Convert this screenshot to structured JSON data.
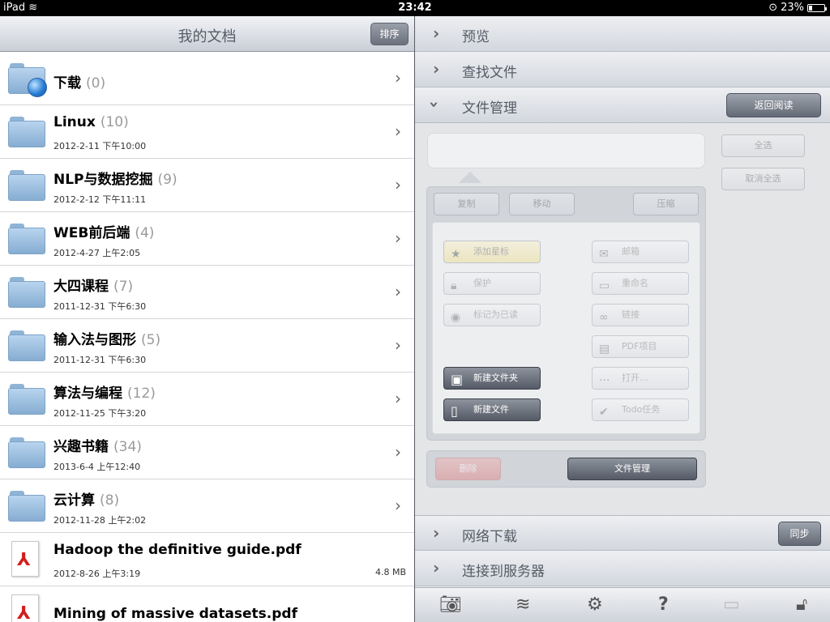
{
  "status": {
    "device": "iPad",
    "time": "23:42",
    "battery": "23%",
    "battery_level": 0.23
  },
  "left": {
    "title": "我的文档",
    "sort_label": "排序",
    "rows": [
      {
        "name": "下载",
        "count": "(0)",
        "date": "",
        "size": "",
        "kind": "download-folder"
      },
      {
        "name": "Linux",
        "count": "(10)",
        "date": "2012-2-11 下午10:00",
        "size": "",
        "kind": "folder"
      },
      {
        "name": "NLP与数据挖掘",
        "count": "(9)",
        "date": "2012-2-12 下午11:11",
        "size": "",
        "kind": "folder"
      },
      {
        "name": "WEB前后端",
        "count": "(4)",
        "date": "2012-4-27 上午2:05",
        "size": "",
        "kind": "folder"
      },
      {
        "name": "大四课程",
        "count": "(7)",
        "date": "2011-12-31 下午6:30",
        "size": "",
        "kind": "folder"
      },
      {
        "name": "输入法与图形",
        "count": "(5)",
        "date": "2011-12-31 下午6:30",
        "size": "",
        "kind": "folder"
      },
      {
        "name": "算法与编程",
        "count": "(12)",
        "date": "2012-11-25 下午3:20",
        "size": "",
        "kind": "folder"
      },
      {
        "name": "兴趣书籍",
        "count": "(34)",
        "date": "2013-6-4 上午12:40",
        "size": "",
        "kind": "folder"
      },
      {
        "name": "云计算",
        "count": "(8)",
        "date": "2012-11-28 上午2:02",
        "size": "",
        "kind": "folder"
      },
      {
        "name": "Hadoop the definitive guide.pdf",
        "count": "",
        "date": "2012-8-26 上午3:19",
        "size": "4.8 MB",
        "kind": "pdf"
      },
      {
        "name": "Mining of massive datasets.pdf",
        "count": "",
        "date": "",
        "size": "",
        "kind": "pdf"
      }
    ]
  },
  "right": {
    "sections": {
      "preview": "预览",
      "find": "查找文件",
      "manage": "文件管理",
      "back_to_reading": "返回阅读",
      "network": "网络下载",
      "sync": "同步",
      "server": "连接到服务器"
    },
    "panel": {
      "select_all": "全选",
      "deselect_all": "取消全选",
      "copy": "复制",
      "move": "移动",
      "compress": "压缩",
      "add_star": "添加星标",
      "mail": "邮箱",
      "protect": "保护",
      "rename": "重命名",
      "mark_read": "标记为已读",
      "link": "链接",
      "pdf_project": "PDF项目",
      "new_folder": "新建文件夹",
      "open": "打开...",
      "new_file": "新建文件",
      "todo": "Todo任务",
      "delete": "删除",
      "file_manage": "文件管理"
    },
    "toolbar": [
      "camera-icon",
      "wifi-icon",
      "gear-icon",
      "help-icon",
      "monitor-icon",
      "lock-icon"
    ]
  }
}
